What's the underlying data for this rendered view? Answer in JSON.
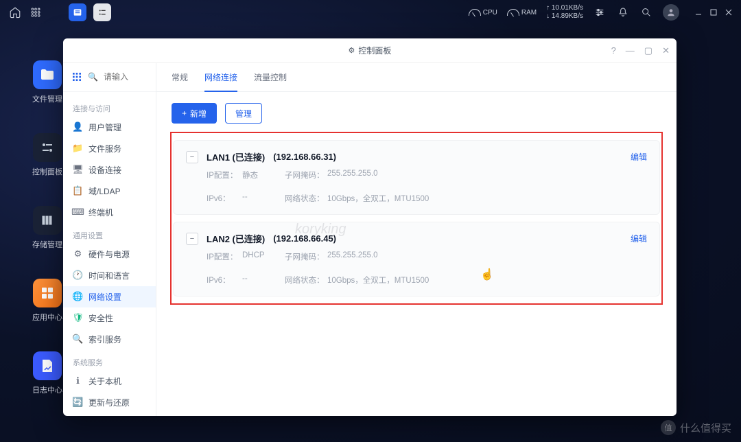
{
  "topbar": {
    "cpu_label": "CPU",
    "ram_label": "RAM",
    "net_up": "↑ 10.01KB/s",
    "net_down": "↓ 14.89KB/s"
  },
  "desktop": {
    "items": [
      {
        "label": "文件管理"
      },
      {
        "label": "控制面板"
      },
      {
        "label": "存储管理"
      },
      {
        "label": "应用中心"
      },
      {
        "label": "日志中心"
      }
    ]
  },
  "window": {
    "title": "控制面板",
    "help": "?",
    "search_placeholder": "请输入"
  },
  "sidebar": {
    "sections": [
      {
        "title": "连接与访问",
        "items": [
          {
            "icon": "👤",
            "label": "用户管理",
            "color": "#2563eb"
          },
          {
            "icon": "📁",
            "label": "文件服务",
            "color": "#f59e0b"
          },
          {
            "icon": "🖥",
            "label": "设备连接",
            "color": "#6b7280"
          },
          {
            "icon": "📋",
            "label": "域/LDAP",
            "color": "#6b7280"
          },
          {
            "icon": "⌨",
            "label": "终端机",
            "color": "#6b7280"
          }
        ]
      },
      {
        "title": "通用设置",
        "items": [
          {
            "icon": "⚙",
            "label": "硬件与电源",
            "color": "#6b7280"
          },
          {
            "icon": "🕐",
            "label": "时间和语言",
            "color": "#6b7280"
          },
          {
            "icon": "🌐",
            "label": "网络设置",
            "color": "#2563eb",
            "active": true
          },
          {
            "icon": "🛡",
            "label": "安全性",
            "color": "#10b981"
          },
          {
            "icon": "🔍",
            "label": "索引服务",
            "color": "#6b7280"
          }
        ]
      },
      {
        "title": "系统服务",
        "items": [
          {
            "icon": "ℹ",
            "label": "关于本机",
            "color": "#6b7280"
          },
          {
            "icon": "🔄",
            "label": "更新与还原",
            "color": "#2563eb"
          }
        ]
      }
    ]
  },
  "tabs": [
    {
      "label": "常规"
    },
    {
      "label": "网络连接",
      "active": true
    },
    {
      "label": "流量控制"
    }
  ],
  "buttons": {
    "add": "新增",
    "manage": "管理"
  },
  "lans": [
    {
      "name": "LAN1 (已连接)",
      "ip": "(192.168.66.31)",
      "edit": "编辑",
      "rows": [
        {
          "k1": "IP配置：",
          "v1": "静态",
          "k2": "子网掩码：",
          "v2": "255.255.255.0"
        },
        {
          "k1": "IPv6：",
          "v1": "--",
          "k2": "网络状态：",
          "v2": "10Gbps，全双工，MTU1500"
        }
      ]
    },
    {
      "name": "LAN2 (已连接)",
      "ip": "(192.168.66.45)",
      "edit": "编辑",
      "rows": [
        {
          "k1": "IP配置：",
          "v1": "DHCP",
          "k2": "子网掩码：",
          "v2": "255.255.255.0"
        },
        {
          "k1": "IPv6：",
          "v1": "--",
          "k2": "网络状态：",
          "v2": "10Gbps，全双工，MTU1500"
        }
      ]
    }
  ],
  "watermark": {
    "center": "koryking",
    "br": "什么值得买",
    "badge": "值"
  }
}
